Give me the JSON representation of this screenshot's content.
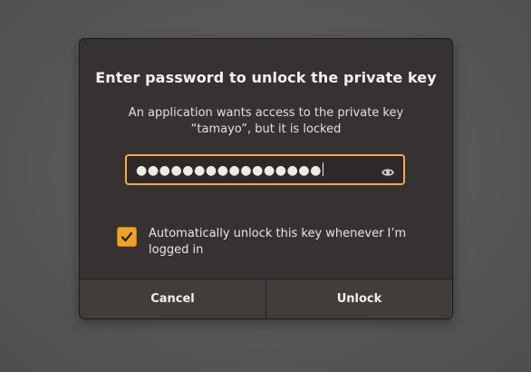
{
  "dialog": {
    "title": "Enter password to unlock the private key",
    "message_line1": "An application wants access to the private key",
    "message_line2": "“tamayo”, but it is locked",
    "password": {
      "masked_value": "●●●●●●●●●●●●●●●●",
      "length": 16,
      "reveal_icon": "eye-icon"
    },
    "auto_unlock": {
      "checked": true,
      "label": "Automatically unlock this key whenever I’m logged in"
    },
    "buttons": {
      "cancel_label": "Cancel",
      "unlock_label": "Unlock"
    }
  },
  "colors": {
    "accent": "#f2a22b",
    "focus_border": "#f6a94a",
    "dialog_bg": "#353231",
    "button_bg": "#413d3b",
    "desktop_bg": "#5a5958"
  }
}
